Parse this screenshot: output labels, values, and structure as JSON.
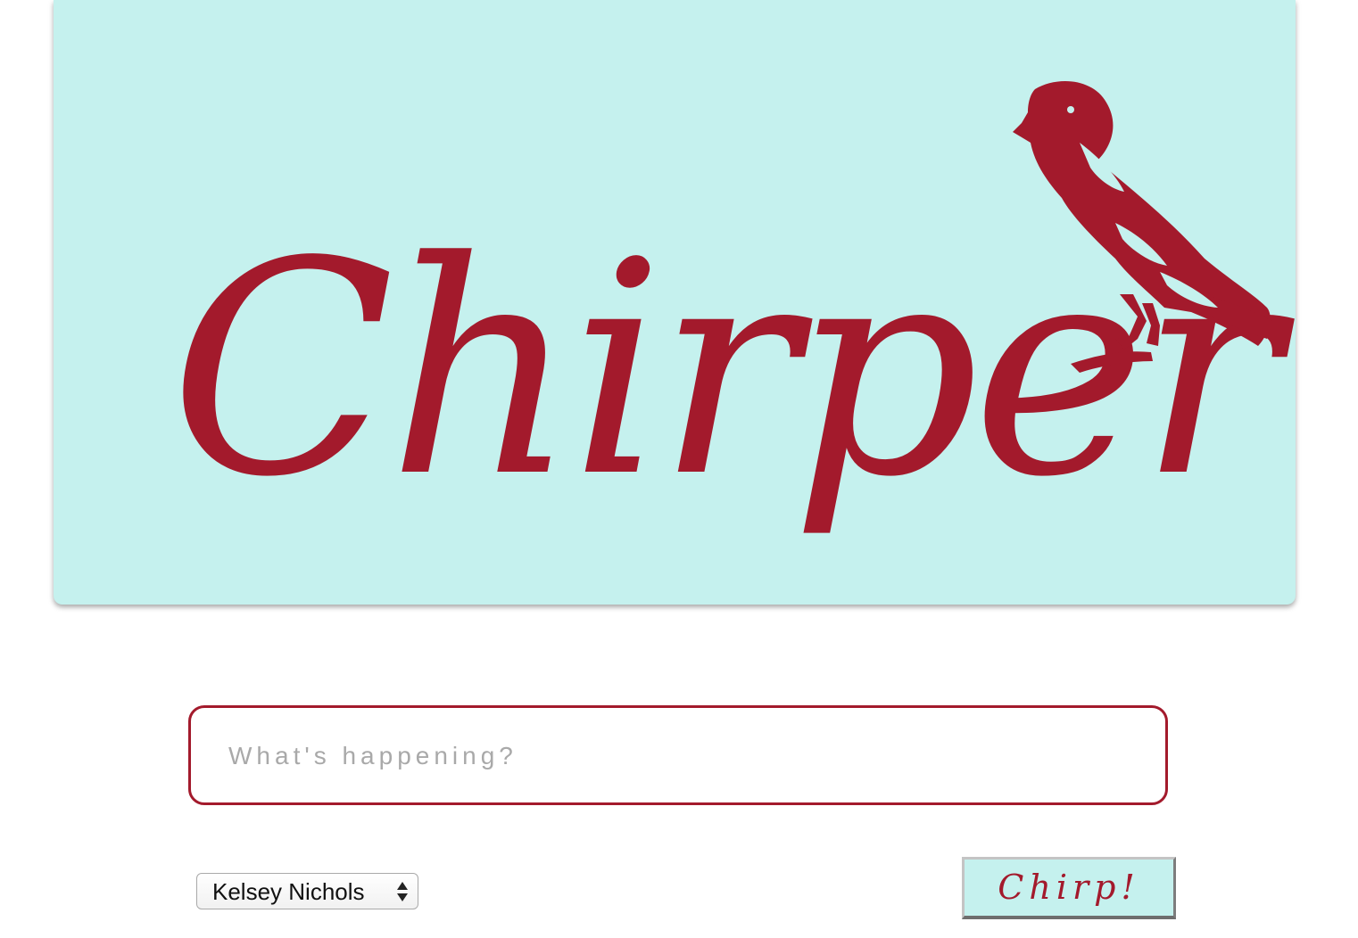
{
  "header": {
    "logo_text": "Chirper",
    "logo_icon": "bird-icon",
    "background_color": "#c5f1ee",
    "accent_color": "#a31a2c"
  },
  "composer": {
    "placeholder": "What's happening?",
    "value": ""
  },
  "author_select": {
    "selected": "Kelsey Nichols",
    "icon": "select-arrows-icon"
  },
  "submit": {
    "label": "Chirp!"
  }
}
